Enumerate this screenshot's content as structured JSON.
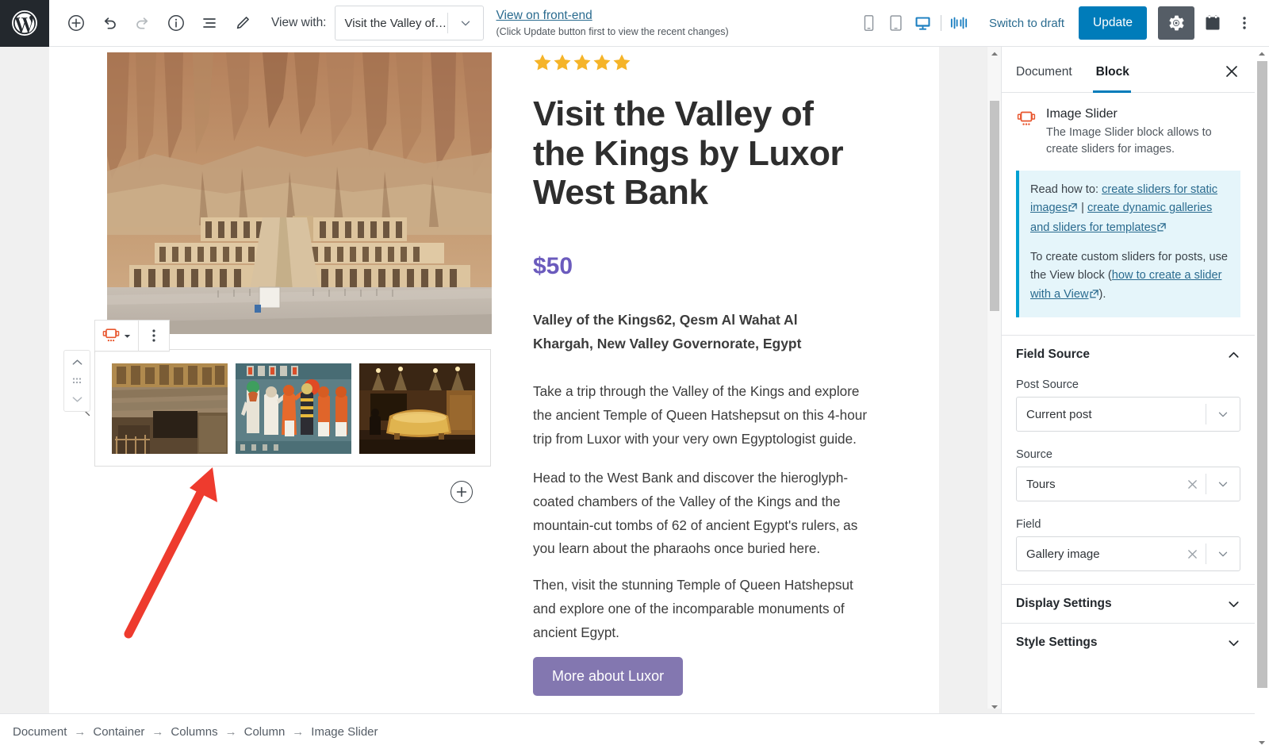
{
  "toolbar": {
    "icons": [
      "add-block-icon",
      "undo-icon",
      "redo-icon",
      "info-icon",
      "list-view-icon",
      "edit-pencil-icon"
    ],
    "view_with_label": "View with:",
    "view_with_value": "Visit the Valley of the...",
    "front_end_link": "View on front-end",
    "front_end_note": "(Click Update button first to view the recent changes)",
    "device_icons": [
      "mobile-icon",
      "tablet-icon",
      "desktop-icon",
      "split-view-icon"
    ],
    "switch_to_draft": "Switch to draft",
    "update_label": "Update",
    "gear_icon": "settings-gear-icon",
    "calendar_icon": "calendar-icon",
    "kebab_icon": "more-options-icon",
    "accent_blue": "#007cba",
    "gear_bg": "#555d66"
  },
  "post": {
    "stars": 5,
    "star_color": "#f5b429",
    "title": "Visit the Valley of the Kings by Luxor West Bank",
    "price": "$50",
    "price_color": "#6b5bbd",
    "address": "Valley of the Kings62, Qesm Al Wahat Al Khargah, New Valley Governorate, Egypt",
    "paragraphs": [
      "Take a trip through the Valley of the Kings and explore the ancient Temple of Queen Hatshepsut on this 4-hour trip from Luxor with your very own Egyptologist guide.",
      "Head to the West Bank and discover the hieroglyph-coated chambers of the Valley of the Kings and the mountain-cut tombs of 62 of ancient Egypt's rulers, as you learn about the pharaohs once buried here.",
      "Then, visit the stunning Temple of Queen Hatshepsut and explore one of the incomparable monuments of ancient Egypt."
    ],
    "cta_label": "More about Luxor",
    "cta_color": "#8377b0"
  },
  "slider_block": {
    "toolbar_block_icon": "image-slider-block-icon",
    "toolbar_caret_icon": "chevron-down-icon",
    "toolbar_more_icon": "more-options-vertical-icon",
    "mover_up_icon": "move-up-icon",
    "mover_drag_icon": "drag-handle-icon",
    "mover_down_icon": "move-down-icon",
    "prev_icon": "chevron-left-icon",
    "next_icon": "chevron-right-icon",
    "add_block_icon": "add-block-plus-icon",
    "slides": [
      "tomb-interior-thumbnail",
      "hieroglyph-mural-thumbnail",
      "sarcophagus-chamber-thumbnail"
    ]
  },
  "annotation": {
    "arrow_color": "#ee3b2e",
    "name": "red-pointer-arrow"
  },
  "sidebar": {
    "tabs": [
      {
        "label": "Document",
        "active": false
      },
      {
        "label": "Block",
        "active": true
      }
    ],
    "close_icon": "close-icon",
    "block": {
      "icon": "image-slider-block-icon",
      "icon_color": "#e8562e",
      "name": "Image Slider",
      "description": "The Image Slider block allows to create sliders for images."
    },
    "notice": {
      "line1_prefix": "Read how to: ",
      "link1": "create sliders for static images",
      "separator": " | ",
      "link2": "create dynamic galleries and sliders for templates",
      "p2_prefix": "To create custom sliders for posts, use the View block (",
      "link3": "how to create a slider with a View",
      "p2_suffix": ").",
      "bg": "#e5f5fa",
      "border": "#00a0d2",
      "link_color": "#2a6b8f"
    },
    "panels": [
      {
        "title": "Field Source",
        "expanded": true,
        "chevron": "chevron-up-icon",
        "fields": [
          {
            "label": "Post Source",
            "value": "Current post",
            "clearable": false
          },
          {
            "label": "Source",
            "value": "Tours",
            "clearable": true
          },
          {
            "label": "Field",
            "value": "Gallery image",
            "clearable": true
          }
        ]
      },
      {
        "title": "Display Settings",
        "expanded": false,
        "chevron": "chevron-down-icon"
      },
      {
        "title": "Style Settings",
        "expanded": false,
        "chevron": "chevron-down-icon"
      }
    ]
  },
  "breadcrumb": {
    "separator": "→",
    "items": [
      "Document",
      "Container",
      "Columns",
      "Column",
      "Image Slider"
    ]
  }
}
